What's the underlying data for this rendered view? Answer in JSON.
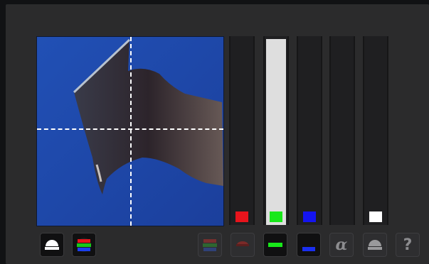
{
  "preview": {
    "name": "color-picker-preview",
    "background": "#1d45a6"
  },
  "channels": [
    {
      "name": "red",
      "level": 0.0,
      "swatch": "#e8141c"
    },
    {
      "name": "green",
      "level": 1.0,
      "swatch": "#18e81a"
    },
    {
      "name": "blue",
      "level": 0.0,
      "swatch": "#1414f0"
    },
    {
      "name": "alpha",
      "level": 0.0,
      "swatch": null
    },
    {
      "name": "luminance",
      "level": 0.0,
      "swatch": "#ffffff"
    }
  ],
  "toolbar": {
    "left_buttons": [
      {
        "icon": "luminance-display-icon",
        "active": true
      },
      {
        "icon": "rgb-display-icon",
        "active": true
      }
    ],
    "right_buttons": [
      {
        "icon": "rgb-channels-icon",
        "active": false
      },
      {
        "icon": "red-channel-icon",
        "active": false
      },
      {
        "icon": "green-channel-icon",
        "active": true
      },
      {
        "icon": "blue-channel-icon",
        "active": true
      },
      {
        "icon": "alpha-channel-icon",
        "active": false,
        "glyph": "α"
      },
      {
        "icon": "luminance-channel-icon",
        "active": false
      },
      {
        "icon": "help-icon",
        "active": false,
        "glyph": "?"
      }
    ]
  }
}
